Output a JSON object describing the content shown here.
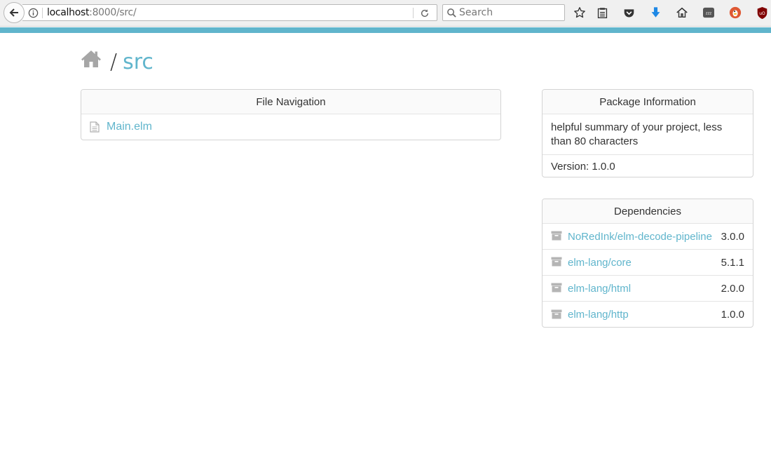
{
  "browser": {
    "url_host": "localhost",
    "url_path": ":8000/src/",
    "search_placeholder": "Search",
    "accent_color": "#60b5cc",
    "toolbar_icons": [
      "star-icon",
      "reading-list-icon",
      "pocket-icon",
      "download-icon",
      "home-icon",
      "sleep-tab-icon",
      "duckduckgo-icon",
      "ublock-icon"
    ]
  },
  "breadcrumb": {
    "separator": "/",
    "current": "src"
  },
  "file_navigation": {
    "title": "File Navigation",
    "files": [
      {
        "name": "Main.elm"
      }
    ]
  },
  "package_information": {
    "title": "Package Information",
    "summary": "helpful summary of your project, less than 80 characters",
    "version": "Version: 1.0.0"
  },
  "dependencies": {
    "title": "Dependencies",
    "items": [
      {
        "name": "NoRedInk/elm-decode-pipeline",
        "version": "3.0.0"
      },
      {
        "name": "elm-lang/core",
        "version": "5.1.1"
      },
      {
        "name": "elm-lang/html",
        "version": "2.0.0"
      },
      {
        "name": "elm-lang/http",
        "version": "1.0.0"
      }
    ]
  }
}
